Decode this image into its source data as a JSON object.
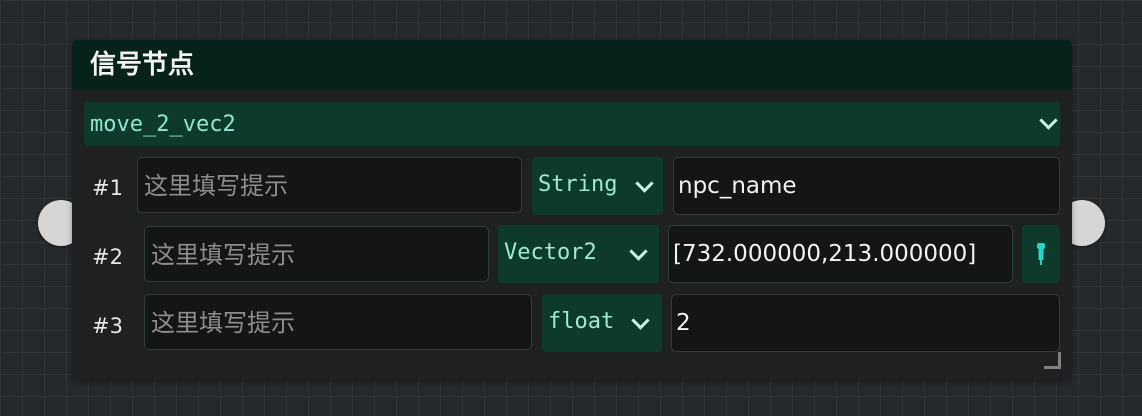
{
  "node": {
    "title": "信号节点",
    "signal": {
      "selected": "move_2_vec2",
      "icon": "chevron-down-icon"
    },
    "params": [
      {
        "index": "#1",
        "hint_placeholder": "这里填写提示",
        "type": "String",
        "value": "npc_name"
      },
      {
        "index": "#2",
        "hint_placeholder": "这里填写提示",
        "type": "Vector2",
        "value": "[732.000000,213.000000]"
      },
      {
        "index": "#3",
        "hint_placeholder": "这里填写提示",
        "type": "float",
        "value": "2"
      }
    ],
    "pick_button_icon": "eyedropper-icon"
  },
  "colors": {
    "header_bg": "#07211b",
    "accent_bg": "#0e3a2c",
    "accent_text": "#8fe7cf",
    "port": "#d6d6d6"
  }
}
